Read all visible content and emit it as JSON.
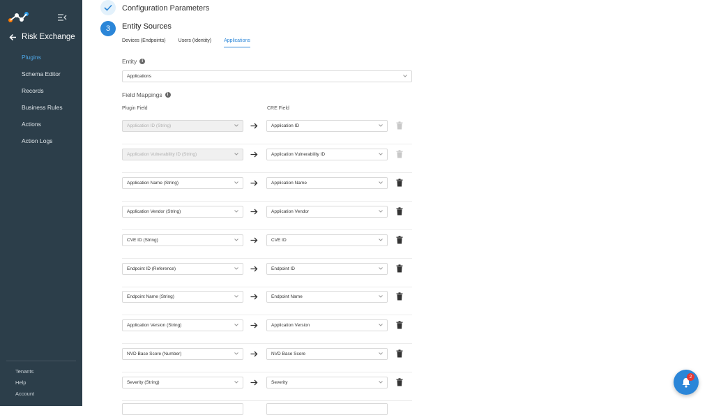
{
  "app": {
    "title": "Risk Exchange"
  },
  "sidebar": {
    "items": [
      {
        "label": "Plugins",
        "active": true
      },
      {
        "label": "Schema Editor",
        "active": false
      },
      {
        "label": "Records",
        "active": false
      },
      {
        "label": "Business Rules",
        "active": false
      },
      {
        "label": "Actions",
        "active": false
      },
      {
        "label": "Action Logs",
        "active": false
      }
    ],
    "footer": [
      {
        "label": "Tenants"
      },
      {
        "label": "Help"
      },
      {
        "label": "Account"
      }
    ]
  },
  "steps": {
    "prev_title": "Configuration Parameters",
    "current_number": "3",
    "current_title": "Entity Sources"
  },
  "tabs": [
    {
      "label": "Devices (Endpoints)",
      "active": false
    },
    {
      "label": "Users (Identity)",
      "active": false
    },
    {
      "label": "Applications",
      "active": true
    }
  ],
  "entity": {
    "label": "Entity",
    "value": "Applications"
  },
  "mappings": {
    "label": "Field Mappings",
    "plugin_field_header": "Plugin Field",
    "cre_field_header": "CRE Field",
    "rows": [
      {
        "plugin": "Application ID (String)",
        "cre": "Application ID",
        "locked": true
      },
      {
        "plugin": "Application Vulnerability ID (String)",
        "cre": "Application Vulnerability ID",
        "locked": true
      },
      {
        "plugin": "Application Name (String)",
        "cre": "Application Name",
        "locked": false
      },
      {
        "plugin": "Application Vendor (String)",
        "cre": "Application Vendor",
        "locked": false
      },
      {
        "plugin": "CVE ID (String)",
        "cre": "CVE ID",
        "locked": false
      },
      {
        "plugin": "Endpoint ID (Reference)",
        "cre": "Endpoint ID",
        "locked": false
      },
      {
        "plugin": "Endpoint Name (String)",
        "cre": "Endpoint Name",
        "locked": false
      },
      {
        "plugin": "Application Version (String)",
        "cre": "Application Version",
        "locked": false
      },
      {
        "plugin": "NVD Base Score (Number)",
        "cre": "NVD Base Score",
        "locked": false
      },
      {
        "plugin": "Severity (String)",
        "cre": "Severity",
        "locked": false
      }
    ]
  },
  "notifications": {
    "count": "2"
  },
  "colors": {
    "sidebar_bg": "#2c3e4a",
    "accent": "#2b86d8",
    "active_nav": "#4fa8e8",
    "badge": "#e53935"
  }
}
